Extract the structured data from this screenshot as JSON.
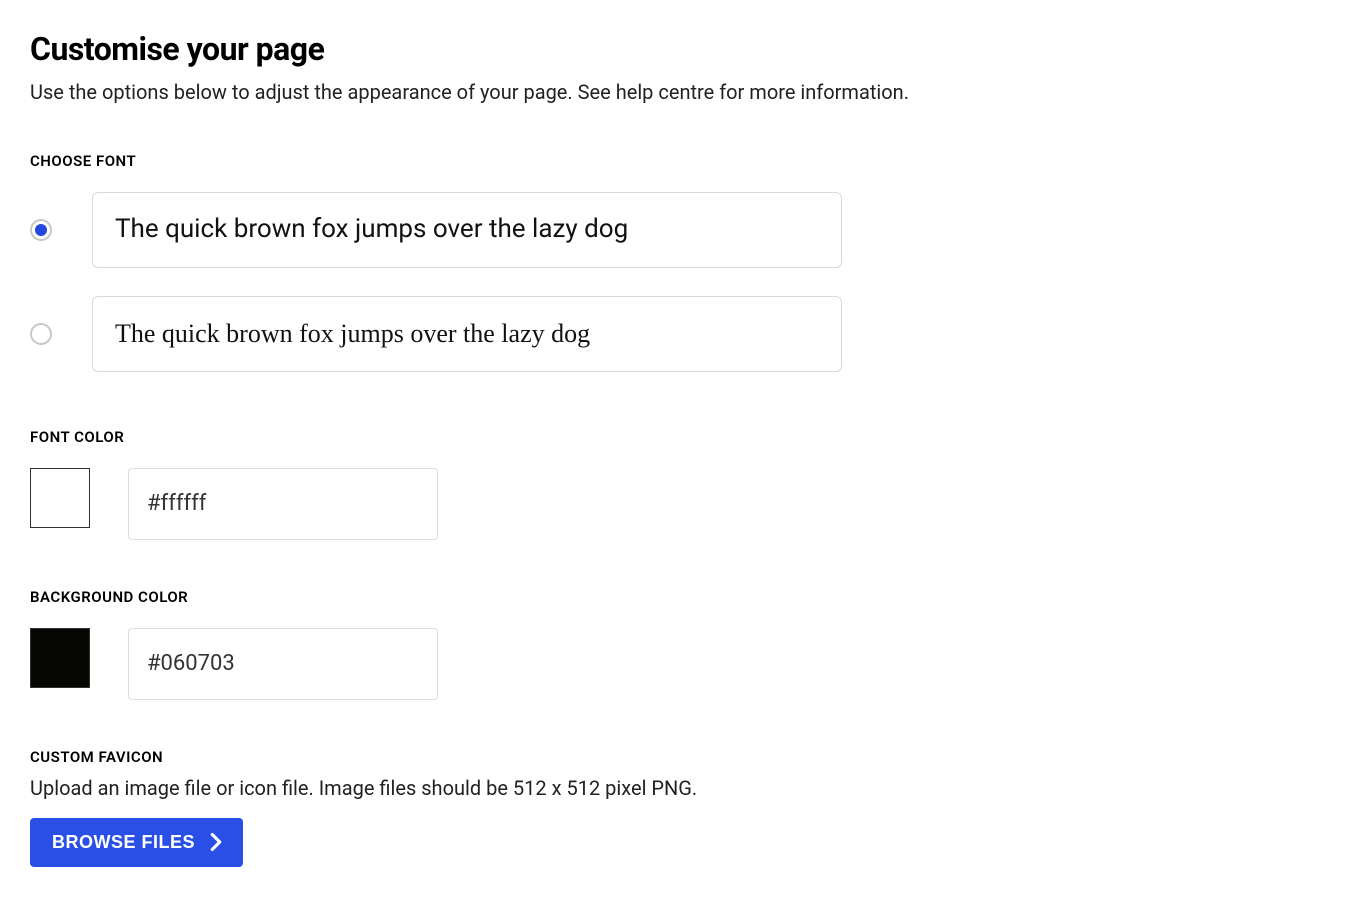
{
  "header": {
    "title": "Customise your page",
    "subtitle": "Use the options below to adjust the appearance of your page. See help centre for more information."
  },
  "chooseFont": {
    "label": "CHOOSE FONT",
    "sampleText": "The quick brown fox jumps over the lazy dog",
    "options": [
      {
        "style": "sans",
        "selected": true
      },
      {
        "style": "serif",
        "selected": false
      }
    ]
  },
  "fontColor": {
    "label": "FONT COLOR",
    "value": "#ffffff",
    "swatch": "#ffffff"
  },
  "backgroundColor": {
    "label": "BACKGROUND COLOR",
    "value": "#060703",
    "swatch": "#060703"
  },
  "favicon": {
    "label": "CUSTOM FAVICON",
    "description": "Upload an image file or icon file. Image files should be 512 x 512 pixel PNG.",
    "buttonLabel": "BROWSE FILES"
  }
}
